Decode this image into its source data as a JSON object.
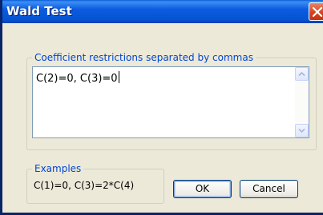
{
  "window": {
    "title": "Wald Test",
    "title_bar_color": "#0553d2",
    "close_button_color": "#d6441e"
  },
  "restrictions": {
    "label": "Coefficient restrictions separated by commas",
    "value": "C(2)=0, C(3)=0"
  },
  "examples": {
    "label": "Examples",
    "text": "C(1)=0,  C(3)=2*C(4)"
  },
  "buttons": {
    "ok_label": "OK",
    "cancel_label": "Cancel"
  }
}
